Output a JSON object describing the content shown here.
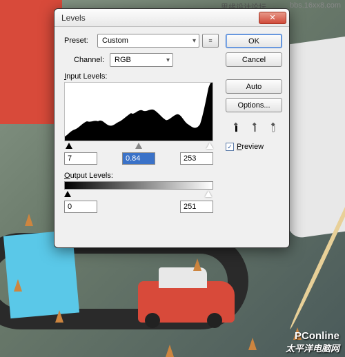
{
  "dialog": {
    "title": "Levels",
    "preset_label": "Preset:",
    "preset_value": "Custom",
    "channel_label": "Channel:",
    "channel_value": "RGB",
    "input_label": "Input Levels:",
    "input_black": "7",
    "input_gamma": "0.84",
    "input_white": "253",
    "output_label": "Output Levels:",
    "output_black": "0",
    "output_white": "251"
  },
  "buttons": {
    "ok": "OK",
    "cancel": "Cancel",
    "auto": "Auto",
    "options": "Options..."
  },
  "preview": {
    "label": "Preview",
    "checked": "✓"
  },
  "icons": {
    "menu": "≡",
    "close": "✕"
  },
  "watermarks": {
    "top_left": "思缘设计论坛",
    "top_right": "bbs.16xx8.com",
    "bottom_brand": "PConline",
    "bottom_cn": "太平洋电脑网"
  }
}
